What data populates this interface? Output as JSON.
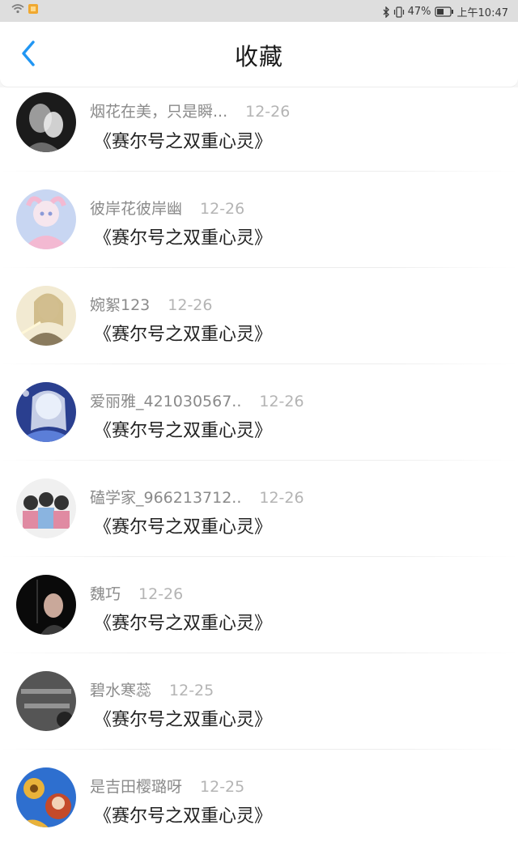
{
  "status_bar": {
    "battery": "47%",
    "time": "上午10:47"
  },
  "header": {
    "title": "收藏"
  },
  "items": [
    {
      "username": "烟花在美，只是瞬...",
      "date": "12-26",
      "title": "《赛尔号之双重心灵》",
      "avatar_colors": [
        "#1b1b1b",
        "#9b9b9b",
        "#f0f0f0"
      ]
    },
    {
      "username": "彼岸花彼岸幽",
      "date": "12-26",
      "title": "《赛尔号之双重心灵》",
      "avatar_colors": [
        "#c8d6f2",
        "#f3b9d2",
        "#8c9bd8"
      ]
    },
    {
      "username": "婉絮123",
      "date": "12-26",
      "title": "《赛尔号之双重心灵》",
      "avatar_colors": [
        "#f2ead2",
        "#c8b27a",
        "#5e4b2c"
      ]
    },
    {
      "username": "爱丽雅_421030567..",
      "date": "12-26",
      "title": "《赛尔号之双重心灵》",
      "avatar_colors": [
        "#5b7ed8",
        "#d8e0f6",
        "#2a3f8f"
      ]
    },
    {
      "username": "磕学家_966213712..",
      "date": "12-26",
      "title": "《赛尔号之双重心灵》",
      "avatar_colors": [
        "#f0f0f0",
        "#e08aa2",
        "#333333"
      ]
    },
    {
      "username": "魏巧",
      "date": "12-26",
      "title": "《赛尔号之双重心灵》",
      "avatar_colors": [
        "#0a0a0a",
        "#c9a89a",
        "#3a3a3a"
      ]
    },
    {
      "username": "碧水寒蕊",
      "date": "12-25",
      "title": "《赛尔号之双重心灵》",
      "avatar_colors": [
        "#555555",
        "#bdbdbd",
        "#222222"
      ]
    },
    {
      "username": "是吉田樱璐呀",
      "date": "12-25",
      "title": "《赛尔号之双重心灵》",
      "avatar_colors": [
        "#2e6fcf",
        "#e9b23a",
        "#c44a2a"
      ]
    }
  ]
}
